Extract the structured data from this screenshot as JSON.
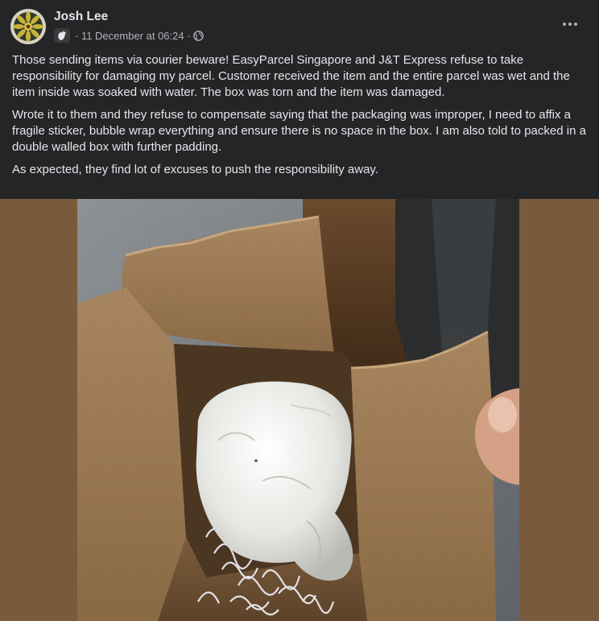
{
  "post": {
    "author": "Josh Lee",
    "timestamp": "· 11 December at 06:24 ·",
    "badge_icon": "wave-hand-icon",
    "privacy_icon": "globe-icon",
    "more_icon": "more-options-icon",
    "paragraphs": [
      "Those sending items via courier beware! EasyParcel Singapore and J&T Express refuse to take responsibility for damaging my parcel. Customer received the item and the entire parcel was wet and the item inside was soaked with water. The box was torn and the item was damaged.",
      "Wrote it to them and they refuse to compensate saying that the packaging was improper, I need to affix a fragile sticker, bubble wrap everything and ensure there is no space in the box. I am also told to packed in a double walled box with further padding.",
      "As expected, they find lot of excuses to push the responsibility away."
    ]
  },
  "colors": {
    "background": "#242526",
    "text_primary": "#e4e6eb",
    "text_secondary": "#b0b3b8",
    "photo_backdrop": "#7a5a3c"
  }
}
